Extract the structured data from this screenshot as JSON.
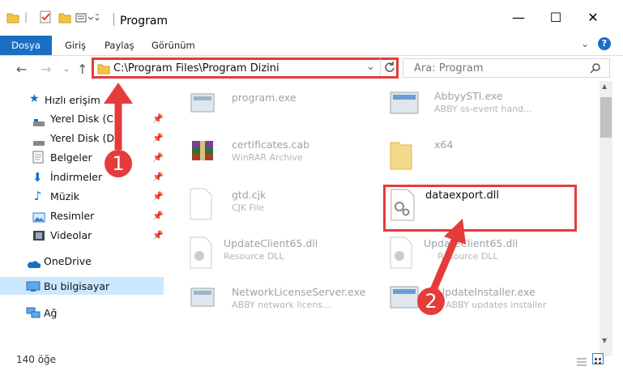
{
  "window": {
    "title": "Program"
  },
  "ribbon": {
    "tabs": [
      "Dosya",
      "Giriş",
      "Paylaş",
      "Görünüm"
    ]
  },
  "address": {
    "path": "C:\\Program Files\\Program Dizini"
  },
  "search": {
    "placeholder": "Ara: Program"
  },
  "sidebar": {
    "quick_access": "Hızlı erişim",
    "items": [
      {
        "label": "Yerel Disk (C:)"
      },
      {
        "label": "Yerel Disk (D:)"
      },
      {
        "label": "Belgeler"
      },
      {
        "label": "İndirmeler"
      },
      {
        "label": "Müzik"
      },
      {
        "label": "Resimler"
      },
      {
        "label": "Videolar"
      }
    ],
    "onedrive": "OneDrive",
    "this_pc": "Bu bilgisayar",
    "network": "Ağ"
  },
  "files": [
    {
      "name": "program.exe",
      "sub": ""
    },
    {
      "name": "AbbyySTI.exe",
      "sub": "ABBY ss-event hand..."
    },
    {
      "name": "certificates.cab",
      "sub": "WinRAR Archive"
    },
    {
      "name": "x64",
      "sub": ""
    },
    {
      "name": "gtd.cjk",
      "sub": "CJK File"
    },
    {
      "name": "dataexport.dll",
      "sub": ""
    },
    {
      "name": "UpdateClient65.dll",
      "sub": "Resource DLL"
    },
    {
      "name": "UpdateClient65.dll",
      "sub": "Resource DLL"
    },
    {
      "name": "NetworkLicenseServer.exe",
      "sub": "ABBY network licens..."
    },
    {
      "name": "UpdateInstaller.exe",
      "sub": "ABBY updates installer"
    }
  ],
  "status": {
    "count": "140 öğe"
  },
  "callouts": [
    "1",
    "2"
  ],
  "colors": {
    "accent": "#1a6fc4",
    "highlight": "#e53b3b"
  }
}
